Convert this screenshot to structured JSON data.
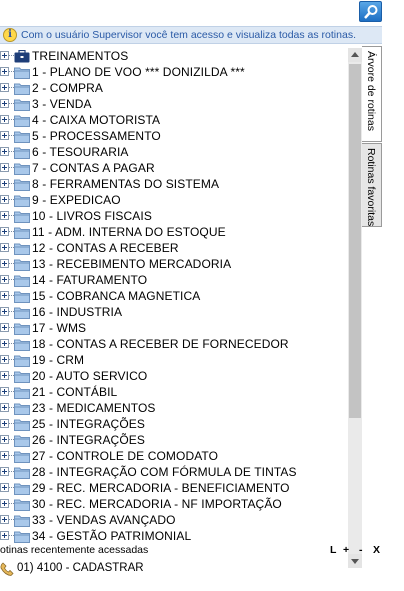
{
  "info_bar": {
    "message": "Com o usuário Supervisor você tem acesso e visualiza todas as rotinas."
  },
  "tree": {
    "root": "TREINAMENTOS",
    "items": [
      "1 - PLANO DE VOO    ***  DONIZILDA  ***",
      "2 - COMPRA",
      "3 - VENDA",
      "4 - CAIXA MOTORISTA",
      "5 - PROCESSAMENTO",
      "6 - TESOURARIA",
      "7 - CONTAS A PAGAR",
      "8 - FERRAMENTAS DO SISTEMA",
      "9 - EXPEDICAO",
      "10 - LIVROS FISCAIS",
      "11 - ADM. INTERNA DO ESTOQUE",
      "12 - CONTAS A RECEBER",
      "13 - RECEBIMENTO MERCADORIA",
      "14 - FATURAMENTO",
      "15 - COBRANCA MAGNETICA",
      "16 - INDUSTRIA",
      "17 - WMS",
      "18 - CONTAS A RECEBER DE FORNECEDOR",
      "19 - CRM",
      "20 - AUTO SERVICO",
      "21 - CONTÁBIL",
      "23 - MEDICAMENTOS",
      "25 - INTEGRAÇÕES",
      "26 - INTEGRAÇÕES",
      "27 - CONTROLE DE COMODATO",
      "28 - INTEGRAÇÃO COM FÓRMULA DE TINTAS",
      "29 - REC. MERCADORIA - BENEFICIAMENTO",
      "30 - REC. MERCADORIA - NF IMPORTAÇÃO",
      "33 - VENDAS AVANÇADO",
      "34 - GESTÃO PATRIMONIAL"
    ]
  },
  "side_tabs": {
    "tree": "Árvore de rotinas",
    "favorites": "Rotinas favoritas"
  },
  "recent": {
    "title": "otinas recentemente acessadas",
    "controls": [
      "L",
      "+",
      "-",
      "X"
    ],
    "items": [
      "01)  4100 - CADASTRAR"
    ]
  },
  "colors": {
    "info_text": "#2a5aa6",
    "info_bg": "#dde8f5",
    "folder": "#8fb6e0",
    "search_btn": "#1d6fc4"
  }
}
